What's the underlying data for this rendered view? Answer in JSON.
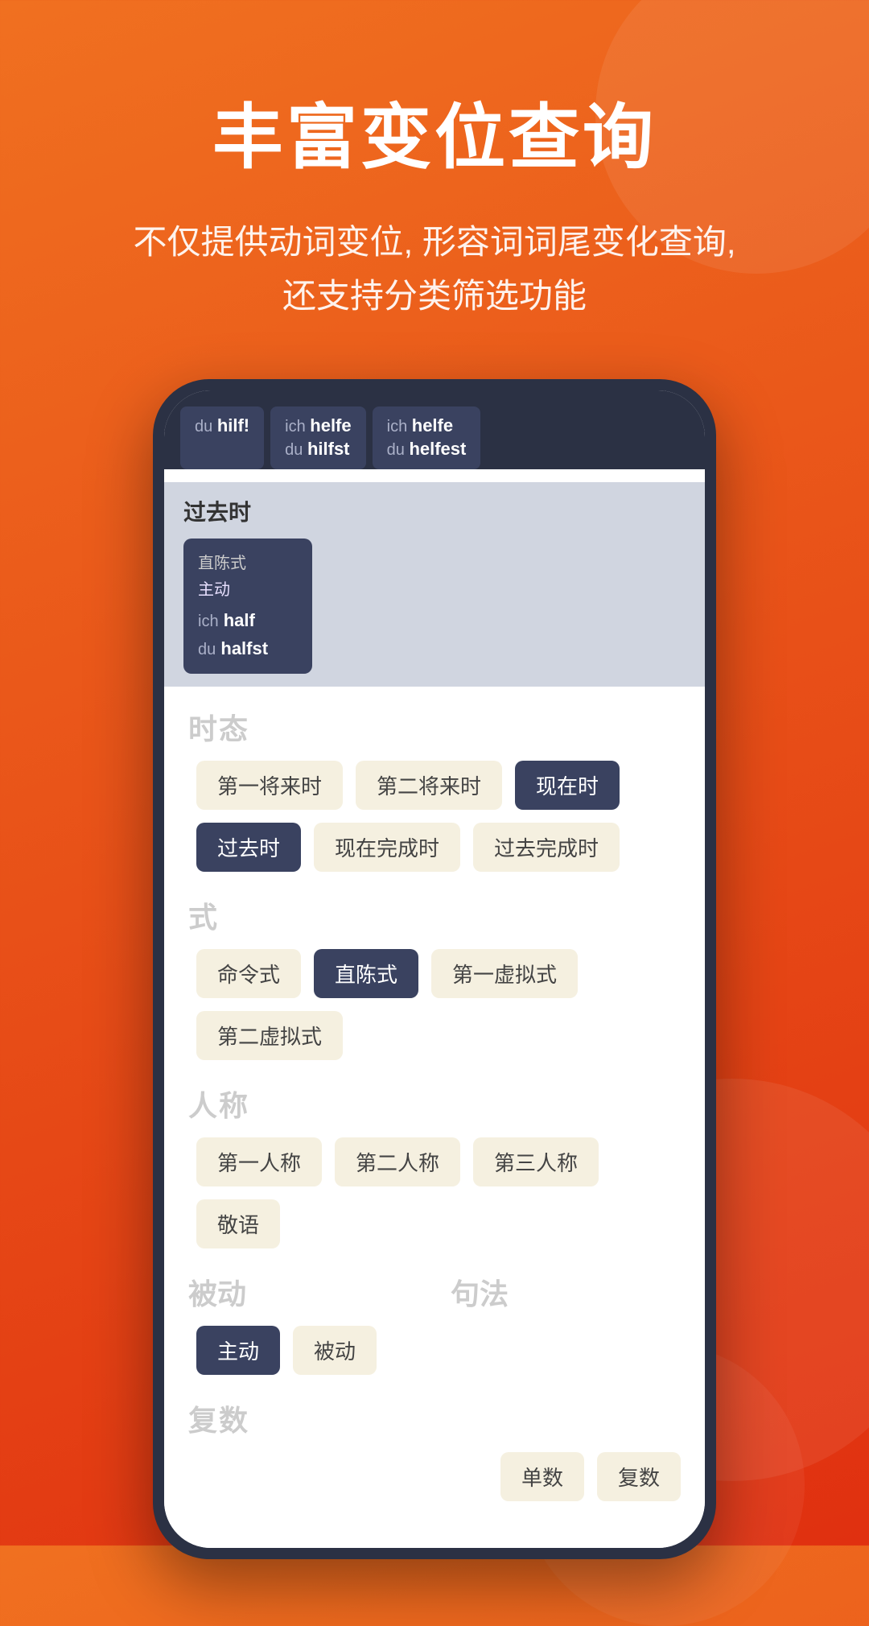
{
  "page": {
    "title": "丰富变位查询",
    "subtitle": "不仅提供动词变位, 形容词词尾变化查询,\n还支持分类筛选功能"
  },
  "phone": {
    "tooltips": [
      {
        "pronoun": "du",
        "form": "hilf!"
      },
      {
        "pronoun": "ich",
        "form": "helfe",
        "pronoun2": "du",
        "form2": "hilfst"
      },
      {
        "pronoun": "ich",
        "form": "helfe",
        "pronoun2": "du",
        "form2": "helfest"
      }
    ],
    "pastTenseLabel": "过去时",
    "conjugationCard": {
      "category": "直陈式",
      "voice": "主动",
      "pronoun1": "ich",
      "verb1": "half",
      "pronoun2": "du",
      "verb2": "halfst"
    },
    "filters": {
      "tense": {
        "title": "时态",
        "pills": [
          "第一将来时",
          "第二将来时",
          "现在时",
          "过去时",
          "现在完成时",
          "过去完成时"
        ]
      },
      "mood": {
        "title": "式",
        "pills": [
          "命令式",
          "直陈式",
          "第一虚拟式",
          "第二虚拟式"
        ]
      },
      "person": {
        "title": "人称",
        "pills": [
          "第一人称",
          "第二人称",
          "第三人称",
          "敬语"
        ]
      },
      "voice": {
        "title": "被动",
        "pills": [
          "主动",
          "被动"
        ]
      },
      "syntax": {
        "title": "句法",
        "pills": []
      },
      "number": {
        "title": "复数",
        "pills": [
          "单数",
          "复数"
        ]
      }
    }
  }
}
